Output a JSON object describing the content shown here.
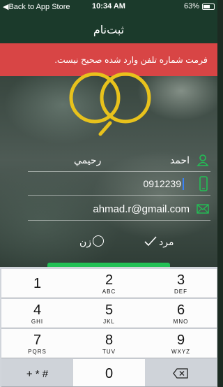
{
  "status_bar": {
    "back_label": "◀Back to App Store",
    "time": "10:34 AM",
    "battery": "63%"
  },
  "nav": {
    "title": "ثبت‌نام"
  },
  "error_banner": {
    "message": "فرمت شماره تلفن وارد شده صحیح نیست."
  },
  "form": {
    "first_name": "احمد",
    "last_name": "رحيمي",
    "phone": "0912239",
    "email": "ahmad.r@gmail.com",
    "gender_male": "مرد",
    "gender_female": "زن",
    "gender_selected": "male"
  },
  "keypad": {
    "keys": [
      {
        "num": "1",
        "letters": ""
      },
      {
        "num": "2",
        "letters": "ABC"
      },
      {
        "num": "3",
        "letters": "DEF"
      },
      {
        "num": "4",
        "letters": "GHI"
      },
      {
        "num": "5",
        "letters": "JKL"
      },
      {
        "num": "6",
        "letters": "MNO"
      },
      {
        "num": "7",
        "letters": "PQRS"
      },
      {
        "num": "8",
        "letters": "TUV"
      },
      {
        "num": "9",
        "letters": "WXYZ"
      },
      {
        "num": "+ * #",
        "letters": ""
      },
      {
        "num": "0",
        "letters": ""
      }
    ]
  },
  "colors": {
    "accent_green": "#22c055",
    "error_red": "#d84545",
    "logo_yellow": "#e8c21c"
  }
}
